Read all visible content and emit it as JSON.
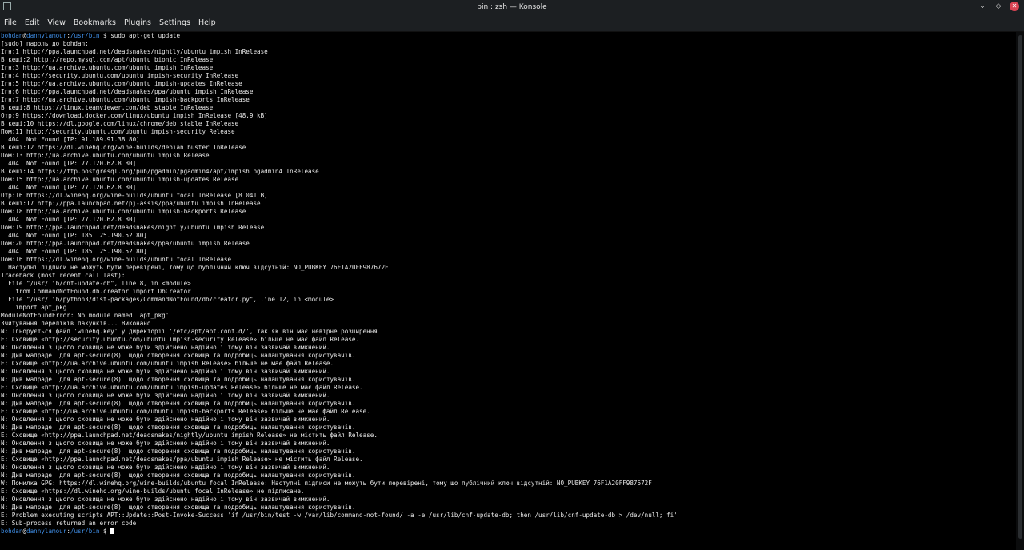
{
  "window": {
    "title": "bin : zsh — Konsole"
  },
  "menu": [
    "File",
    "Edit",
    "View",
    "Bookmarks",
    "Plugins",
    "Settings",
    "Help"
  ],
  "prompt": {
    "user": "bohdan",
    "at": "@",
    "host": "dannylamour",
    "sep": ":",
    "path": "/usr/bin",
    "symbol": " $ ",
    "command": "sudo apt-get update"
  },
  "output": [
    "[sudo] пароль до bohdan:",
    "Ігн:1 http://ppa.launchpad.net/deadsnakes/nightly/ubuntu impish InRelease",
    "В кеші:2 http://repo.mysql.com/apt/ubuntu bionic InRelease",
    "Ігн:3 http://ua.archive.ubuntu.com/ubuntu impish InRelease",
    "Ігн:4 http://security.ubuntu.com/ubuntu impish-security InRelease",
    "Ігн:5 http://ua.archive.ubuntu.com/ubuntu impish-updates InRelease",
    "Ігн:6 http://ppa.launchpad.net/deadsnakes/ppa/ubuntu impish InRelease",
    "Ігн:7 http://ua.archive.ubuntu.com/ubuntu impish-backports InRelease",
    "В кеші:8 https://linux.teamviewer.com/deb stable InRelease",
    "Отр:9 https://download.docker.com/linux/ubuntu impish InRelease [48,9 kB]",
    "В кеші:10 https://dl.google.com/linux/chrome/deb stable InRelease",
    "Пом:11 http://security.ubuntu.com/ubuntu impish-security Release",
    "  404  Not Found [IP: 91.189.91.38 80]",
    "В кеші:12 https://dl.winehq.org/wine-builds/debian buster InRelease",
    "Пом:13 http://ua.archive.ubuntu.com/ubuntu impish Release",
    "  404  Not Found [IP: 77.120.62.8 80]",
    "В кеші:14 https://ftp.postgresql.org/pub/pgadmin/pgadmin4/apt/impish pgadmin4 InRelease",
    "Пом:15 http://ua.archive.ubuntu.com/ubuntu impish-updates Release",
    "  404  Not Found [IP: 77.120.62.8 80]",
    "Отр:16 https://dl.winehq.org/wine-builds/ubuntu focal InRelease [8 041 B]",
    "В кеші:17 http://ppa.launchpad.net/pj-assis/ppa/ubuntu impish InRelease",
    "Пом:18 http://ua.archive.ubuntu.com/ubuntu impish-backports Release",
    "  404  Not Found [IP: 77.120.62.8 80]",
    "Пом:19 http://ppa.launchpad.net/deadsnakes/nightly/ubuntu impish Release",
    "  404  Not Found [IP: 185.125.190.52 80]",
    "Пом:20 http://ppa.launchpad.net/deadsnakes/ppa/ubuntu impish Release",
    "  404  Not Found [IP: 185.125.190.52 80]",
    "Пом:16 https://dl.winehq.org/wine-builds/ubuntu focal InRelease",
    "  Наступні підписи не можуть бути перевірені, тому що публічний ключ відсутній: NO_PUBKEY 76F1A20FF987672F",
    "Traceback (most recent call last):",
    "  File \"/usr/lib/cnf-update-db\", line 8, in <module>",
    "    from CommandNotFound.db.creator import DbCreator",
    "  File \"/usr/lib/python3/dist-packages/CommandNotFound/db/creator.py\", line 12, in <module>",
    "    import apt_pkg",
    "ModuleNotFoundError: No module named 'apt_pkg'",
    "Зчитування переліків пакунків... Виконано",
    "N: Ігнорується файл 'winehq.key' у директорії '/etc/apt/apt.conf.d/', так як він має невірне розширення",
    "E: Сховище «http://security.ubuntu.com/ubuntu impish-security Release» більше не має файл Release.",
    "N: Оновлення з цього сховища не може бути здійснено надійно і тому він зазвичай вимкнений.",
    "N: Див мапраде  для apt-secure(8)  щодо створення сховища та подробиць налаштування користувачів.",
    "E: Сховище «http://ua.archive.ubuntu.com/ubuntu impish Release» більше не має файл Release.",
    "N: Оновлення з цього сховища не може бути здійснено надійно і тому він зазвичай вимкнений.",
    "N: Див мапраде  для apt-secure(8)  щодо створення сховища та подробиць налаштування користувачів.",
    "E: Сховище «http://ua.archive.ubuntu.com/ubuntu impish-updates Release» більше не має файл Release.",
    "N: Оновлення з цього сховища не може бути здійснено надійно і тому він зазвичай вимкнений.",
    "N: Див мапраде  для apt-secure(8)  щодо створення сховища та подробиць налаштування користувачів.",
    "E: Сховище «http://ua.archive.ubuntu.com/ubuntu impish-backports Release» більше не має файл Release.",
    "N: Оновлення з цього сховища не може бути здійснено надійно і тому він зазвичай вимкнений.",
    "N: Див мапраде  для apt-secure(8)  щодо створення сховища та подробиць налаштування користувачів.",
    "E: Сховище «http://ppa.launchpad.net/deadsnakes/nightly/ubuntu impish Release» не містить файл Release.",
    "N: Оновлення з цього сховища не може бути здійснено надійно і тому він зазвичай вимкнений.",
    "N: Див мапраде  для apt-secure(8)  щодо створення сховища та подробиць налаштування користувачів.",
    "E: Сховище «http://ppa.launchpad.net/deadsnakes/ppa/ubuntu impish Release» не містить файл Release.",
    "N: Оновлення з цього сховища не може бути здійснено надійно і тому він зазвичай вимкнений.",
    "N: Див мапраде  для apt-secure(8)  щодо створення сховища та подробиць налаштування користувачів.",
    "W: Помилка GPG: https://dl.winehq.org/wine-builds/ubuntu focal InRelease: Наступні підписи не можуть бути перевірені, тому що публічний ключ відсутній: NO_PUBKEY 76F1A20FF987672F",
    "E: Сховище «https://dl.winehq.org/wine-builds/ubuntu focal InRelease» не підписане.",
    "N: Оновлення з цього сховища не може бути здійснено надійно і тому він зазвичай вимкнений.",
    "N: Див мапраде  для apt-secure(8)  щодо створення сховища та подробиць налаштування користувачів.",
    "E: Problem executing scripts APT::Update::Post-Invoke-Success 'if /usr/bin/test -w /var/lib/command-not-found/ -a -e /usr/lib/cnf-update-db; then /usr/lib/cnf-update-db > /dev/null; fi'",
    "E: Sub-process returned an error code"
  ],
  "colors": {
    "prompt_user": "#3f8ee6",
    "background": "#000000",
    "text": "#e6e6e6",
    "close_button": "#da4453"
  }
}
